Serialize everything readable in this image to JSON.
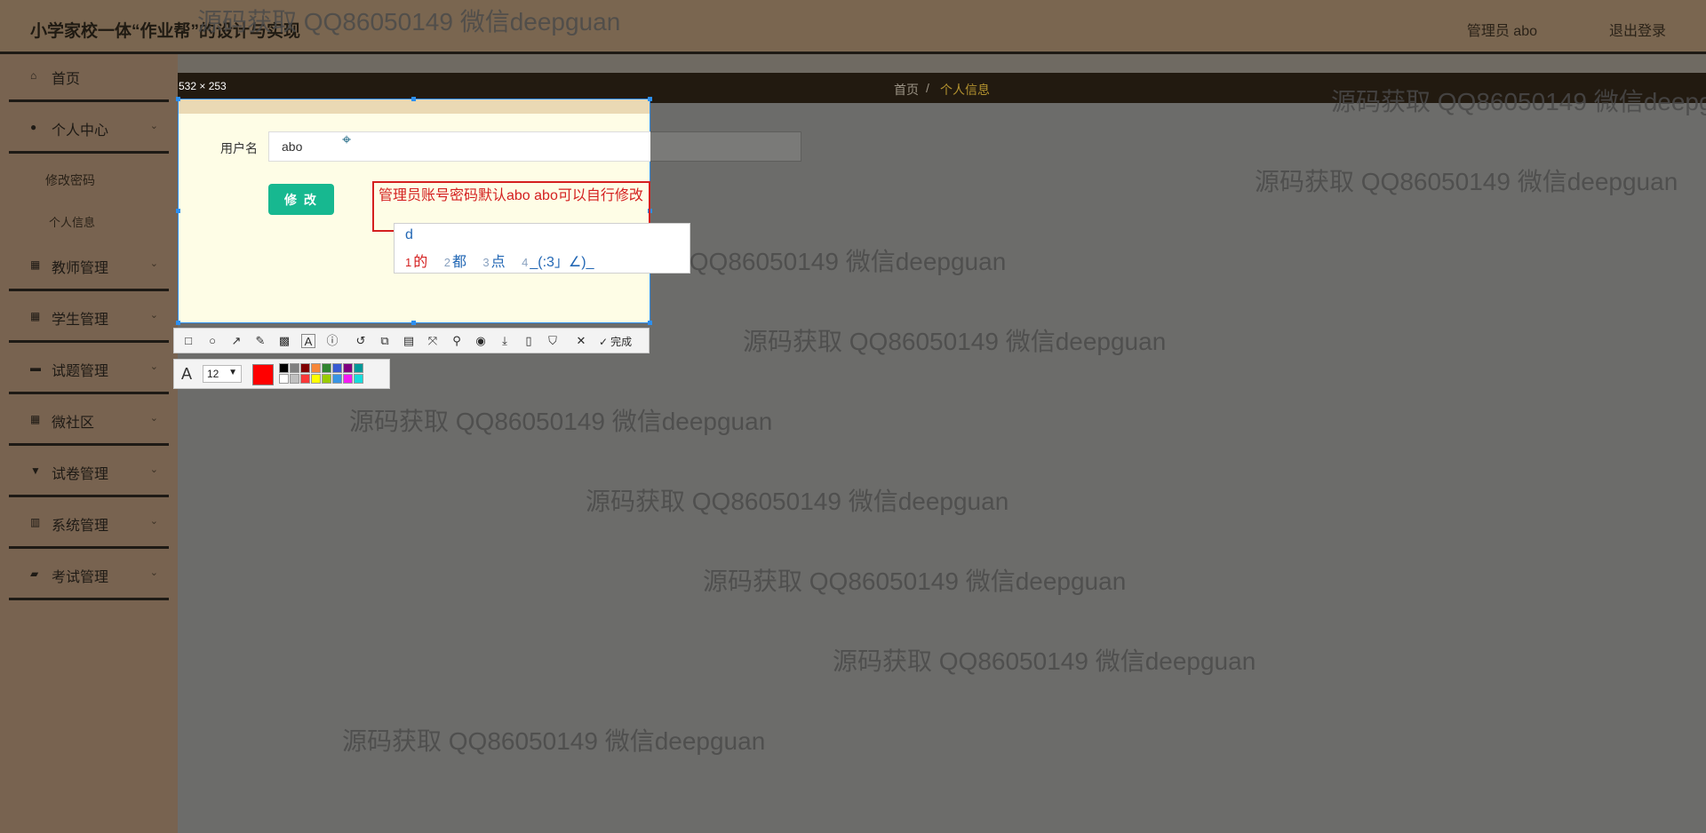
{
  "header": {
    "brand": "小学家校一体“作业帮”的设计与实现",
    "user": "管理员 abo",
    "logout": "退出登录"
  },
  "sidebar": {
    "items": [
      {
        "label": "首页",
        "icon": "home-icon"
      },
      {
        "label": "个人中心",
        "icon": "user-icon"
      },
      {
        "label": "教师管理",
        "icon": "grid-icon"
      },
      {
        "label": "学生管理",
        "icon": "apps-icon"
      },
      {
        "label": "试题管理",
        "icon": "book-icon"
      },
      {
        "label": "微社区",
        "icon": "grid-icon"
      },
      {
        "label": "试卷管理",
        "icon": "cup-icon"
      },
      {
        "label": "系统管理",
        "icon": "library-icon"
      },
      {
        "label": "考试管理",
        "icon": "chat-icon"
      }
    ],
    "sub_items": [
      "修改密码",
      "个人信息"
    ]
  },
  "breadcrumb": {
    "home": "首页",
    "sep": "/",
    "current": "个人信息"
  },
  "form": {
    "username_label": "用户名",
    "username_value": "abo",
    "modify_button": "修 改"
  },
  "screenshot_tool": {
    "size_label": "532 × 253",
    "annotation_text": "管理员账号密码默认abo abo可以自行修改",
    "done_label": "完成",
    "font_size": "12",
    "current_color": "#ff0000",
    "palette": [
      "#000000",
      "#808080",
      "#800000",
      "#f7883a",
      "#308430",
      "#385ad3",
      "#800080",
      "#009999",
      "#ffffff",
      "#c0c0c0",
      "#fb3838",
      "#ffff00",
      "#99cc00",
      "#3894e4",
      "#f31bf3",
      "#16dcdc"
    ]
  },
  "ime": {
    "input": "d",
    "candidates": [
      {
        "num": "1",
        "text": "的"
      },
      {
        "num": "2",
        "text": "都"
      },
      {
        "num": "3",
        "text": "点"
      },
      {
        "num": "4",
        "text": "_(:3」∠)_"
      }
    ]
  },
  "watermark": "源码获取 QQ86050149 微信deepguan"
}
